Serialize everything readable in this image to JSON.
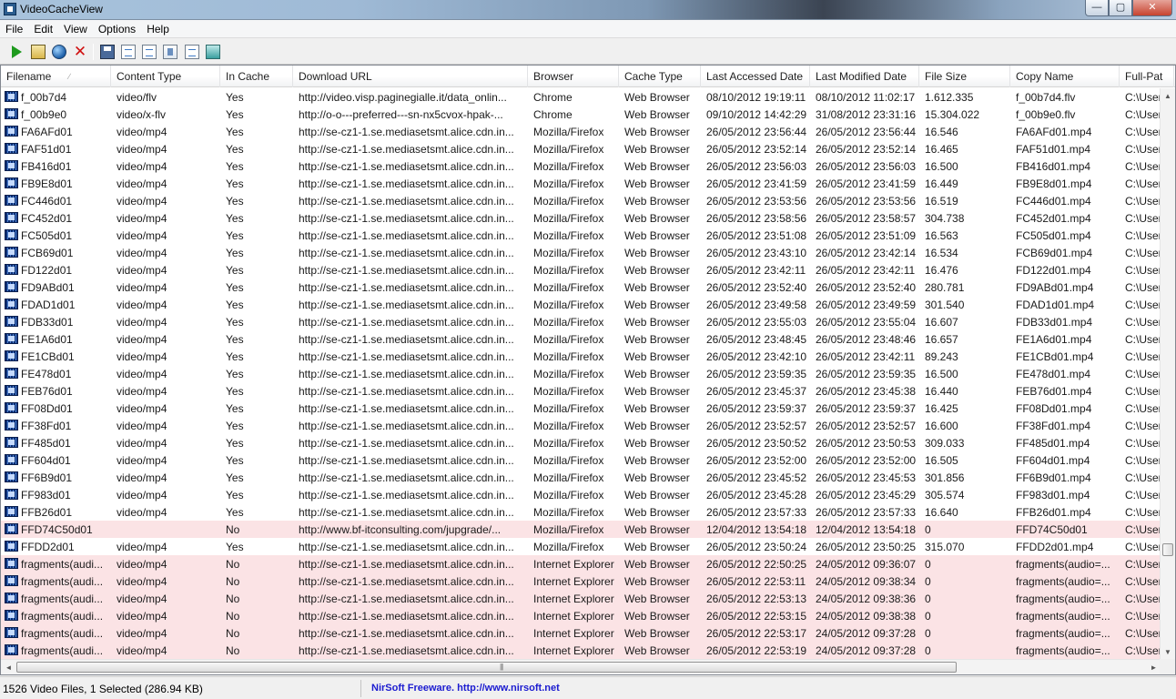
{
  "window": {
    "title": "VideoCacheView",
    "minimize": "—",
    "maximize": "▢",
    "close": "✕"
  },
  "menu": [
    "File",
    "Edit",
    "View",
    "Options",
    "Help"
  ],
  "toolbar": {
    "icons": [
      "start-icon",
      "scan-icon",
      "web-icon",
      "delete-icon",
      "save-icon",
      "refresh-icon",
      "copy-icon",
      "properties-icon",
      "report-icon",
      "exit-icon"
    ]
  },
  "columns": [
    {
      "label": "Filename",
      "sorted": true,
      "sort_glyph": "∕"
    },
    {
      "label": "Content Type"
    },
    {
      "label": "In Cache"
    },
    {
      "label": "Download URL"
    },
    {
      "label": "Browser"
    },
    {
      "label": "Cache Type"
    },
    {
      "label": "Last Accessed Date"
    },
    {
      "label": "Last Modified Date"
    },
    {
      "label": "File Size"
    },
    {
      "label": "Copy Name"
    },
    {
      "label": "Full-Pat"
    }
  ],
  "rows": [
    {
      "filename": "f_00b7d4",
      "content_type": "video/flv",
      "in_cache": "Yes",
      "url": "http://video.visp.paginegialle.it/data_onlin...",
      "browser": "Chrome",
      "cache_type": "Web Browser",
      "last_accessed": "08/10/2012 19:19:11",
      "last_modified": "08/10/2012 11:02:17",
      "file_size": "1.612.335",
      "copy_name": "f_00b7d4.flv",
      "full_path": "C:\\User"
    },
    {
      "filename": "f_00b9e0",
      "content_type": "video/x-flv",
      "in_cache": "Yes",
      "url": "http://o-o---preferred---sn-nx5cvox-hpak-...",
      "browser": "Chrome",
      "cache_type": "Web Browser",
      "last_accessed": "09/10/2012 14:42:29",
      "last_modified": "31/08/2012 23:31:16",
      "file_size": "15.304.022",
      "copy_name": "f_00b9e0.flv",
      "full_path": "C:\\User"
    },
    {
      "filename": "FA6AFd01",
      "content_type": "video/mp4",
      "in_cache": "Yes",
      "url": "http://se-cz1-1.se.mediasetsmt.alice.cdn.in...",
      "browser": "Mozilla/Firefox",
      "cache_type": "Web Browser",
      "last_accessed": "26/05/2012 23:56:44",
      "last_modified": "26/05/2012 23:56:44",
      "file_size": "16.546",
      "copy_name": "FA6AFd01.mp4",
      "full_path": "C:\\User"
    },
    {
      "filename": "FAF51d01",
      "content_type": "video/mp4",
      "in_cache": "Yes",
      "url": "http://se-cz1-1.se.mediasetsmt.alice.cdn.in...",
      "browser": "Mozilla/Firefox",
      "cache_type": "Web Browser",
      "last_accessed": "26/05/2012 23:52:14",
      "last_modified": "26/05/2012 23:52:14",
      "file_size": "16.465",
      "copy_name": "FAF51d01.mp4",
      "full_path": "C:\\User"
    },
    {
      "filename": "FB416d01",
      "content_type": "video/mp4",
      "in_cache": "Yes",
      "url": "http://se-cz1-1.se.mediasetsmt.alice.cdn.in...",
      "browser": "Mozilla/Firefox",
      "cache_type": "Web Browser",
      "last_accessed": "26/05/2012 23:56:03",
      "last_modified": "26/05/2012 23:56:03",
      "file_size": "16.500",
      "copy_name": "FB416d01.mp4",
      "full_path": "C:\\User"
    },
    {
      "filename": "FB9E8d01",
      "content_type": "video/mp4",
      "in_cache": "Yes",
      "url": "http://se-cz1-1.se.mediasetsmt.alice.cdn.in...",
      "browser": "Mozilla/Firefox",
      "cache_type": "Web Browser",
      "last_accessed": "26/05/2012 23:41:59",
      "last_modified": "26/05/2012 23:41:59",
      "file_size": "16.449",
      "copy_name": "FB9E8d01.mp4",
      "full_path": "C:\\User"
    },
    {
      "filename": "FC446d01",
      "content_type": "video/mp4",
      "in_cache": "Yes",
      "url": "http://se-cz1-1.se.mediasetsmt.alice.cdn.in...",
      "browser": "Mozilla/Firefox",
      "cache_type": "Web Browser",
      "last_accessed": "26/05/2012 23:53:56",
      "last_modified": "26/05/2012 23:53:56",
      "file_size": "16.519",
      "copy_name": "FC446d01.mp4",
      "full_path": "C:\\User"
    },
    {
      "filename": "FC452d01",
      "content_type": "video/mp4",
      "in_cache": "Yes",
      "url": "http://se-cz1-1.se.mediasetsmt.alice.cdn.in...",
      "browser": "Mozilla/Firefox",
      "cache_type": "Web Browser",
      "last_accessed": "26/05/2012 23:58:56",
      "last_modified": "26/05/2012 23:58:57",
      "file_size": "304.738",
      "copy_name": "FC452d01.mp4",
      "full_path": "C:\\User"
    },
    {
      "filename": "FC505d01",
      "content_type": "video/mp4",
      "in_cache": "Yes",
      "url": "http://se-cz1-1.se.mediasetsmt.alice.cdn.in...",
      "browser": "Mozilla/Firefox",
      "cache_type": "Web Browser",
      "last_accessed": "26/05/2012 23:51:08",
      "last_modified": "26/05/2012 23:51:09",
      "file_size": "16.563",
      "copy_name": "FC505d01.mp4",
      "full_path": "C:\\User"
    },
    {
      "filename": "FCB69d01",
      "content_type": "video/mp4",
      "in_cache": "Yes",
      "url": "http://se-cz1-1.se.mediasetsmt.alice.cdn.in...",
      "browser": "Mozilla/Firefox",
      "cache_type": "Web Browser",
      "last_accessed": "26/05/2012 23:43:10",
      "last_modified": "26/05/2012 23:42:14",
      "file_size": "16.534",
      "copy_name": "FCB69d01.mp4",
      "full_path": "C:\\User"
    },
    {
      "filename": "FD122d01",
      "content_type": "video/mp4",
      "in_cache": "Yes",
      "url": "http://se-cz1-1.se.mediasetsmt.alice.cdn.in...",
      "browser": "Mozilla/Firefox",
      "cache_type": "Web Browser",
      "last_accessed": "26/05/2012 23:42:11",
      "last_modified": "26/05/2012 23:42:11",
      "file_size": "16.476",
      "copy_name": "FD122d01.mp4",
      "full_path": "C:\\User"
    },
    {
      "filename": "FD9ABd01",
      "content_type": "video/mp4",
      "in_cache": "Yes",
      "url": "http://se-cz1-1.se.mediasetsmt.alice.cdn.in...",
      "browser": "Mozilla/Firefox",
      "cache_type": "Web Browser",
      "last_accessed": "26/05/2012 23:52:40",
      "last_modified": "26/05/2012 23:52:40",
      "file_size": "280.781",
      "copy_name": "FD9ABd01.mp4",
      "full_path": "C:\\User"
    },
    {
      "filename": "FDAD1d01",
      "content_type": "video/mp4",
      "in_cache": "Yes",
      "url": "http://se-cz1-1.se.mediasetsmt.alice.cdn.in...",
      "browser": "Mozilla/Firefox",
      "cache_type": "Web Browser",
      "last_accessed": "26/05/2012 23:49:58",
      "last_modified": "26/05/2012 23:49:59",
      "file_size": "301.540",
      "copy_name": "FDAD1d01.mp4",
      "full_path": "C:\\User"
    },
    {
      "filename": "FDB33d01",
      "content_type": "video/mp4",
      "in_cache": "Yes",
      "url": "http://se-cz1-1.se.mediasetsmt.alice.cdn.in...",
      "browser": "Mozilla/Firefox",
      "cache_type": "Web Browser",
      "last_accessed": "26/05/2012 23:55:03",
      "last_modified": "26/05/2012 23:55:04",
      "file_size": "16.607",
      "copy_name": "FDB33d01.mp4",
      "full_path": "C:\\User"
    },
    {
      "filename": "FE1A6d01",
      "content_type": "video/mp4",
      "in_cache": "Yes",
      "url": "http://se-cz1-1.se.mediasetsmt.alice.cdn.in...",
      "browser": "Mozilla/Firefox",
      "cache_type": "Web Browser",
      "last_accessed": "26/05/2012 23:48:45",
      "last_modified": "26/05/2012 23:48:46",
      "file_size": "16.657",
      "copy_name": "FE1A6d01.mp4",
      "full_path": "C:\\User"
    },
    {
      "filename": "FE1CBd01",
      "content_type": "video/mp4",
      "in_cache": "Yes",
      "url": "http://se-cz1-1.se.mediasetsmt.alice.cdn.in...",
      "browser": "Mozilla/Firefox",
      "cache_type": "Web Browser",
      "last_accessed": "26/05/2012 23:42:10",
      "last_modified": "26/05/2012 23:42:11",
      "file_size": "89.243",
      "copy_name": "FE1CBd01.mp4",
      "full_path": "C:\\User"
    },
    {
      "filename": "FE478d01",
      "content_type": "video/mp4",
      "in_cache": "Yes",
      "url": "http://se-cz1-1.se.mediasetsmt.alice.cdn.in...",
      "browser": "Mozilla/Firefox",
      "cache_type": "Web Browser",
      "last_accessed": "26/05/2012 23:59:35",
      "last_modified": "26/05/2012 23:59:35",
      "file_size": "16.500",
      "copy_name": "FE478d01.mp4",
      "full_path": "C:\\User"
    },
    {
      "filename": "FEB76d01",
      "content_type": "video/mp4",
      "in_cache": "Yes",
      "url": "http://se-cz1-1.se.mediasetsmt.alice.cdn.in...",
      "browser": "Mozilla/Firefox",
      "cache_type": "Web Browser",
      "last_accessed": "26/05/2012 23:45:37",
      "last_modified": "26/05/2012 23:45:38",
      "file_size": "16.440",
      "copy_name": "FEB76d01.mp4",
      "full_path": "C:\\User"
    },
    {
      "filename": "FF08Dd01",
      "content_type": "video/mp4",
      "in_cache": "Yes",
      "url": "http://se-cz1-1.se.mediasetsmt.alice.cdn.in...",
      "browser": "Mozilla/Firefox",
      "cache_type": "Web Browser",
      "last_accessed": "26/05/2012 23:59:37",
      "last_modified": "26/05/2012 23:59:37",
      "file_size": "16.425",
      "copy_name": "FF08Dd01.mp4",
      "full_path": "C:\\User"
    },
    {
      "filename": "FF38Fd01",
      "content_type": "video/mp4",
      "in_cache": "Yes",
      "url": "http://se-cz1-1.se.mediasetsmt.alice.cdn.in...",
      "browser": "Mozilla/Firefox",
      "cache_type": "Web Browser",
      "last_accessed": "26/05/2012 23:52:57",
      "last_modified": "26/05/2012 23:52:57",
      "file_size": "16.600",
      "copy_name": "FF38Fd01.mp4",
      "full_path": "C:\\User"
    },
    {
      "filename": "FF485d01",
      "content_type": "video/mp4",
      "in_cache": "Yes",
      "url": "http://se-cz1-1.se.mediasetsmt.alice.cdn.in...",
      "browser": "Mozilla/Firefox",
      "cache_type": "Web Browser",
      "last_accessed": "26/05/2012 23:50:52",
      "last_modified": "26/05/2012 23:50:53",
      "file_size": "309.033",
      "copy_name": "FF485d01.mp4",
      "full_path": "C:\\User"
    },
    {
      "filename": "FF604d01",
      "content_type": "video/mp4",
      "in_cache": "Yes",
      "url": "http://se-cz1-1.se.mediasetsmt.alice.cdn.in...",
      "browser": "Mozilla/Firefox",
      "cache_type": "Web Browser",
      "last_accessed": "26/05/2012 23:52:00",
      "last_modified": "26/05/2012 23:52:00",
      "file_size": "16.505",
      "copy_name": "FF604d01.mp4",
      "full_path": "C:\\User"
    },
    {
      "filename": "FF6B9d01",
      "content_type": "video/mp4",
      "in_cache": "Yes",
      "url": "http://se-cz1-1.se.mediasetsmt.alice.cdn.in...",
      "browser": "Mozilla/Firefox",
      "cache_type": "Web Browser",
      "last_accessed": "26/05/2012 23:45:52",
      "last_modified": "26/05/2012 23:45:53",
      "file_size": "301.856",
      "copy_name": "FF6B9d01.mp4",
      "full_path": "C:\\User"
    },
    {
      "filename": "FF983d01",
      "content_type": "video/mp4",
      "in_cache": "Yes",
      "url": "http://se-cz1-1.se.mediasetsmt.alice.cdn.in...",
      "browser": "Mozilla/Firefox",
      "cache_type": "Web Browser",
      "last_accessed": "26/05/2012 23:45:28",
      "last_modified": "26/05/2012 23:45:29",
      "file_size": "305.574",
      "copy_name": "FF983d01.mp4",
      "full_path": "C:\\User"
    },
    {
      "filename": "FFB26d01",
      "content_type": "video/mp4",
      "in_cache": "Yes",
      "url": "http://se-cz1-1.se.mediasetsmt.alice.cdn.in...",
      "browser": "Mozilla/Firefox",
      "cache_type": "Web Browser",
      "last_accessed": "26/05/2012 23:57:33",
      "last_modified": "26/05/2012 23:57:33",
      "file_size": "16.640",
      "copy_name": "FFB26d01.mp4",
      "full_path": "C:\\User"
    },
    {
      "filename": "FFD74C50d01",
      "content_type": "",
      "in_cache": "No",
      "url": "http://www.bf-itconsulting.com/jupgrade/...",
      "browser": "Mozilla/Firefox",
      "cache_type": "Web Browser",
      "last_accessed": "12/04/2012 13:54:18",
      "last_modified": "12/04/2012 13:54:18",
      "file_size": "0",
      "copy_name": "FFD74C50d01",
      "full_path": "C:\\User"
    },
    {
      "filename": "FFDD2d01",
      "content_type": "video/mp4",
      "in_cache": "Yes",
      "url": "http://se-cz1-1.se.mediasetsmt.alice.cdn.in...",
      "browser": "Mozilla/Firefox",
      "cache_type": "Web Browser",
      "last_accessed": "26/05/2012 23:50:24",
      "last_modified": "26/05/2012 23:50:25",
      "file_size": "315.070",
      "copy_name": "FFDD2d01.mp4",
      "full_path": "C:\\User"
    },
    {
      "filename": "fragments(audi...",
      "content_type": "video/mp4",
      "in_cache": "No",
      "url": "http://se-cz1-1.se.mediasetsmt.alice.cdn.in...",
      "browser": "Internet Explorer",
      "cache_type": "Web Browser",
      "last_accessed": "26/05/2012 22:50:25",
      "last_modified": "24/05/2012 09:36:07",
      "file_size": "0",
      "copy_name": "fragments(audio=...",
      "full_path": "C:\\User"
    },
    {
      "filename": "fragments(audi...",
      "content_type": "video/mp4",
      "in_cache": "No",
      "url": "http://se-cz1-1.se.mediasetsmt.alice.cdn.in...",
      "browser": "Internet Explorer",
      "cache_type": "Web Browser",
      "last_accessed": "26/05/2012 22:53:11",
      "last_modified": "24/05/2012 09:38:34",
      "file_size": "0",
      "copy_name": "fragments(audio=...",
      "full_path": "C:\\User"
    },
    {
      "filename": "fragments(audi...",
      "content_type": "video/mp4",
      "in_cache": "No",
      "url": "http://se-cz1-1.se.mediasetsmt.alice.cdn.in...",
      "browser": "Internet Explorer",
      "cache_type": "Web Browser",
      "last_accessed": "26/05/2012 22:53:13",
      "last_modified": "24/05/2012 09:38:36",
      "file_size": "0",
      "copy_name": "fragments(audio=...",
      "full_path": "C:\\User"
    },
    {
      "filename": "fragments(audi...",
      "content_type": "video/mp4",
      "in_cache": "No",
      "url": "http://se-cz1-1.se.mediasetsmt.alice.cdn.in...",
      "browser": "Internet Explorer",
      "cache_type": "Web Browser",
      "last_accessed": "26/05/2012 22:53:15",
      "last_modified": "24/05/2012 09:38:38",
      "file_size": "0",
      "copy_name": "fragments(audio=...",
      "full_path": "C:\\User"
    },
    {
      "filename": "fragments(audi...",
      "content_type": "video/mp4",
      "in_cache": "No",
      "url": "http://se-cz1-1.se.mediasetsmt.alice.cdn.in...",
      "browser": "Internet Explorer",
      "cache_type": "Web Browser",
      "last_accessed": "26/05/2012 22:53:17",
      "last_modified": "24/05/2012 09:37:28",
      "file_size": "0",
      "copy_name": "fragments(audio=...",
      "full_path": "C:\\User"
    },
    {
      "filename": "fragments(audi...",
      "content_type": "video/mp4",
      "in_cache": "No",
      "url": "http://se-cz1-1.se.mediasetsmt.alice.cdn.in...",
      "browser": "Internet Explorer",
      "cache_type": "Web Browser",
      "last_accessed": "26/05/2012 22:53:19",
      "last_modified": "24/05/2012 09:37:28",
      "file_size": "0",
      "copy_name": "fragments(audio=...",
      "full_path": "C:\\User"
    }
  ],
  "scrollbars": {
    "up": "▲",
    "down": "▼",
    "left": "◄",
    "right": "►",
    "grip": "|||"
  },
  "status": {
    "summary": "1526 Video Files, 1 Selected  (286.94 KB)",
    "link": "NirSoft Freeware.  http://www.nirsoft.net"
  },
  "colors": {
    "not_cached_row": "#fbe3e5",
    "link": "#1b1bd0"
  }
}
